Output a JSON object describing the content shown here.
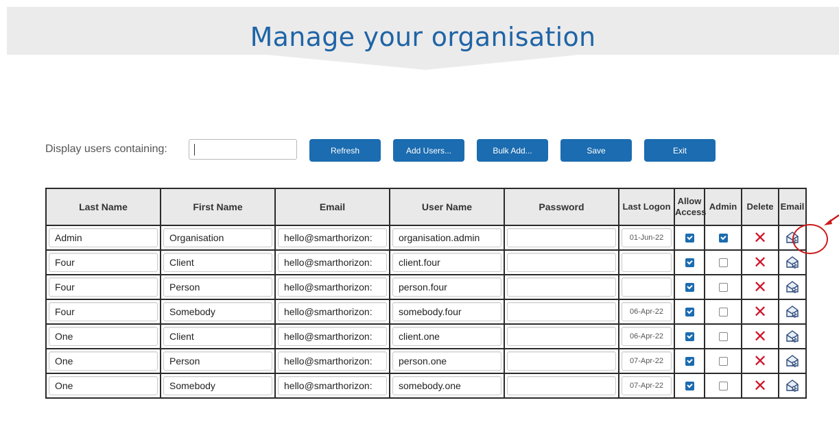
{
  "header": {
    "title": "Manage your organisation"
  },
  "toolbar": {
    "filter_label": "Display users containing:",
    "search_value": "",
    "buttons": {
      "refresh": "Refresh",
      "add_users": "Add Users...",
      "bulk_add": "Bulk Add...",
      "save": "Save",
      "exit": "Exit"
    }
  },
  "table": {
    "headers": {
      "last_name": "Last Name",
      "first_name": "First Name",
      "email": "Email",
      "user_name": "User Name",
      "password": "Password",
      "last_logon": "Last Logon",
      "allow_access_1": "Allow",
      "allow_access_2": "Access",
      "admin": "Admin",
      "delete": "Delete",
      "email_action": "Email"
    },
    "rows": [
      {
        "last_name": "Admin",
        "first_name": "Organisation",
        "email": "hello@smarthorizon:",
        "user_name": "organisation.admin",
        "password": "",
        "last_logon": "01-Jun-22",
        "allow_access": true,
        "admin": true
      },
      {
        "last_name": "Four",
        "first_name": "Client",
        "email": "hello@smarthorizon:",
        "user_name": "client.four",
        "password": "",
        "last_logon": "",
        "allow_access": true,
        "admin": false
      },
      {
        "last_name": "Four",
        "first_name": "Person",
        "email": "hello@smarthorizon:",
        "user_name": "person.four",
        "password": "",
        "last_logon": "",
        "allow_access": true,
        "admin": false
      },
      {
        "last_name": "Four",
        "first_name": "Somebody",
        "email": "hello@smarthorizon:",
        "user_name": "somebody.four",
        "password": "",
        "last_logon": "06-Apr-22",
        "allow_access": true,
        "admin": false
      },
      {
        "last_name": "One",
        "first_name": "Client",
        "email": "hello@smarthorizon:",
        "user_name": "client.one",
        "password": "",
        "last_logon": "06-Apr-22",
        "allow_access": true,
        "admin": false
      },
      {
        "last_name": "One",
        "first_name": "Person",
        "email": "hello@smarthorizon:",
        "user_name": "person.one",
        "password": "",
        "last_logon": "07-Apr-22",
        "allow_access": true,
        "admin": false
      },
      {
        "last_name": "One",
        "first_name": "Somebody",
        "email": "hello@smarthorizon:",
        "user_name": "somebody.one",
        "password": "",
        "last_logon": "07-Apr-22",
        "allow_access": true,
        "admin": false
      }
    ]
  },
  "icons": {
    "delete": "delete-x-icon",
    "email": "send-email-icon",
    "annotation": "red-circle-arrow"
  },
  "colors": {
    "accent": "#1b6cb0",
    "title": "#1f64a6",
    "delete": "#d1142a",
    "annotation": "#cc1a1a"
  }
}
